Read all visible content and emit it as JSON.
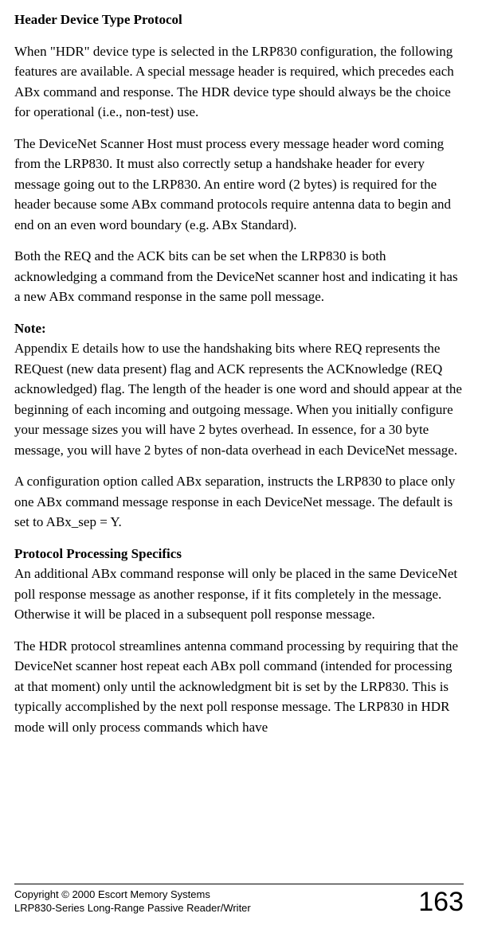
{
  "doc": {
    "heading1": "Header Device Type Protocol",
    "p1": "When \"HDR\" device type is selected in the LRP830 configuration, the following features are available.  A special message header is required, which precedes each ABx command and response.  The HDR device type should always be the choice for operational (i.e., non-test) use.",
    "p2": "The DeviceNet Scanner Host must process every message header word coming from the LRP830.  It must also correctly setup a handshake header for every message going out to the LRP830.  An entire word (2 bytes) is required for the header because some ABx command protocols require antenna data to begin and end on an even word boundary (e.g. ABx Standard).",
    "p3": "Both the REQ and the ACK bits can be set when the LRP830 is both acknowledging a command from the DeviceNet scanner host and indicating it has a new ABx command response in the same poll message.",
    "note_label": "Note:",
    "p4": "Appendix E details how to use the  handshaking bits where REQ  represents the REQuest (new data present) flag and ACK represents the ACKnowledge (REQ acknowledged) flag. The length of the header is one word and should appear at the beginning of each incoming and outgoing message.  When you initially configure your message sizes you will have 2 bytes overhead.  In essence, for a 30 byte message, you will have 2 bytes of non-data overhead in each DeviceNet message.",
    "p5": "A configuration option called ABx separation, instructs the LRP830 to place only one ABx command message response in each DeviceNet message.  The default is set to ABx_sep = Y.",
    "heading2": "Protocol Processing Specifics",
    "p6": "An additional ABx command response will only be placed in the same DeviceNet poll response message as another response, if it fits completely in the message. Otherwise it will be placed in a subsequent poll response message.",
    "p7": "The HDR protocol streamlines antenna command processing by requiring that the DeviceNet scanner host repeat each ABx poll command (intended for processing at that moment) only until the acknowledgment bit is set by the LRP830.  This is typically accomplished by the next poll response message.  The LRP830 in HDR mode will only process commands which have"
  },
  "footer": {
    "line1": "Copyright © 2000 Escort Memory Systems",
    "line2": "LRP830-Series Long-Range Passive Reader/Writer",
    "page": "163"
  }
}
